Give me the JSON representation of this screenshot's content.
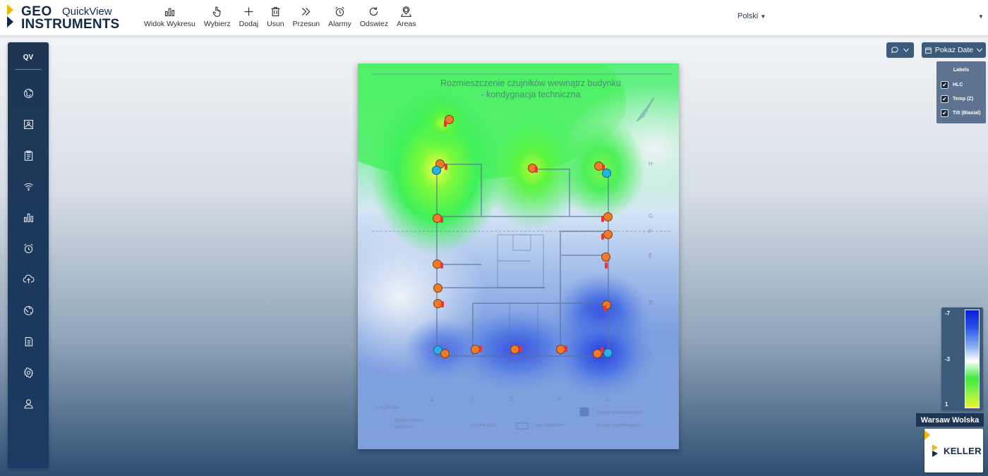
{
  "brand": {
    "geo": "GEO",
    "instruments": "INSTRUMENTS",
    "product": "QuickView"
  },
  "toolbar": [
    {
      "label": "Widok Wykresu",
      "icon": "bar-chart-icon"
    },
    {
      "label": "Wybierz",
      "icon": "pointer-hand-icon"
    },
    {
      "label": "Dodaj",
      "icon": "plus-icon"
    },
    {
      "label": "Usun",
      "icon": "trash-icon"
    },
    {
      "label": "Przesun",
      "icon": "double-chevron-icon"
    },
    {
      "label": "Alarmy",
      "icon": "alarm-clock-icon"
    },
    {
      "label": "Odswiez",
      "icon": "refresh-icon"
    },
    {
      "label": "Areas",
      "icon": "location-pin-icon"
    }
  ],
  "language": "Polski",
  "sidebar": {
    "header": "QV",
    "items": [
      "globe-icon",
      "image-icon",
      "clipboard-icon",
      "wifi-icon",
      "bar-chart-icon",
      "alarm-clock-icon",
      "cloud-upload-icon",
      "earth-icon",
      "document-icon",
      "settings-icon",
      "user-icon"
    ]
  },
  "map": {
    "title_line1": "Rozmieszczenie czujników wewnątrz budynku",
    "title_line2": "- kondygnacja techniczna",
    "row_labels": [
      "H",
      "G",
      "F",
      "E",
      "B",
      "A"
    ],
    "col_labels": [
      "1",
      "2",
      "3",
      "4",
      "5"
    ],
    "legend_title": "Legenda:",
    "legend_items": [
      "ściany konstrukcyjne",
      "ściany wypełniające",
      "czujnik HLC",
      "pochyłomierz",
      "powierzchnia budynku"
    ]
  },
  "controls": {
    "date_button": "Pokaz Date"
  },
  "labels_panel": {
    "header": "Labels",
    "items": [
      {
        "label": "HLC",
        "checked": true
      },
      {
        "label": "Temp (Z)",
        "checked": true
      },
      {
        "label": "Tilt (Biaxial)",
        "checked": true
      }
    ]
  },
  "color_scale": {
    "max_label": "-7",
    "mid_label": "-3",
    "min_label": "1"
  },
  "site": {
    "name": "Warsaw Wolska",
    "partner": "KELLER"
  },
  "colors": {
    "brand_navy": "#13294b",
    "accent_yellow": "#f2b705",
    "sensor_hlc": "#f07a2a",
    "sensor_tilt": "#26b3e8",
    "thermometer": "#e8343a"
  }
}
